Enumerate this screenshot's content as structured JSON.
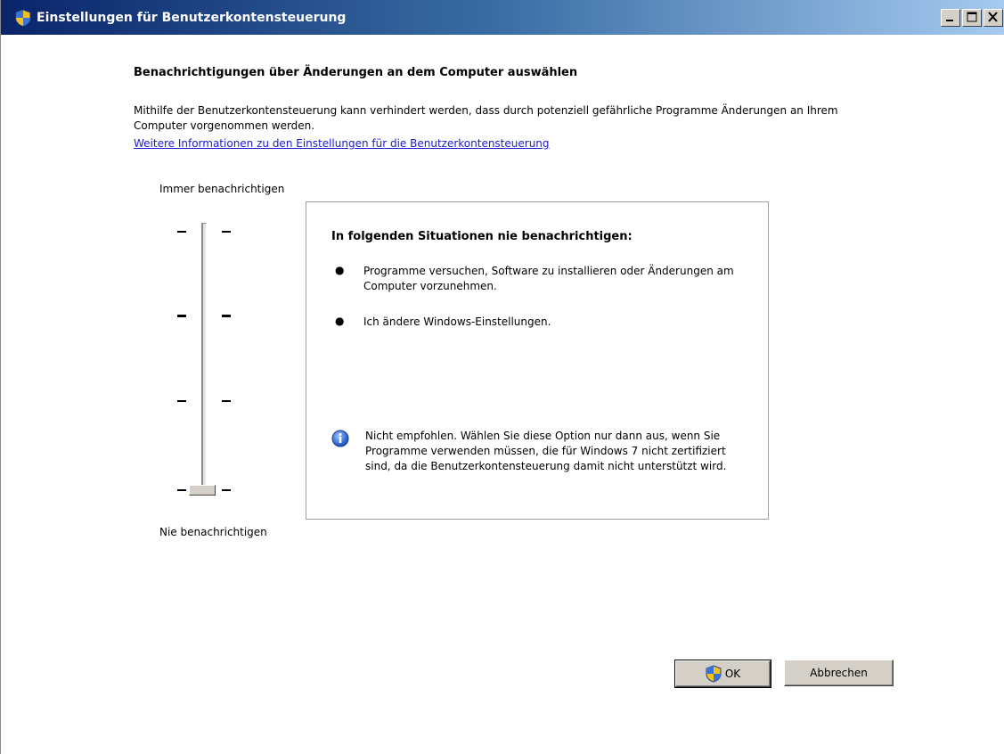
{
  "window": {
    "title": "Einstellungen für Benutzerkontensteuerung",
    "icon": "uac-shield-icon"
  },
  "main": {
    "heading": "Benachrichtigungen über Änderungen an dem Computer auswählen",
    "description": "Mithilfe der Benutzerkontensteuerung kann verhindert werden, dass durch potenziell gefährliche Programme Änderungen an Ihrem Computer vorgenommen werden.",
    "link": "Weitere Informationen zu den Einstellungen für die Benutzerkontensteuerung"
  },
  "slider": {
    "top_label": "Immer benachrichtigen",
    "bottom_label": "Nie benachrichtigen",
    "levels": 4,
    "selected_level": 1
  },
  "info": {
    "title": "In folgenden Situationen nie benachrichtigen:",
    "bullets": [
      "Programme versuchen, Software zu installieren oder Änderungen am Computer vorzunehmen.",
      "Ich ändere Windows-Einstellungen."
    ],
    "warning": "Nicht empfohlen. Wählen Sie diese Option nur dann aus, wenn Sie Programme verwenden müssen, die für Windows 7 nicht zertifiziert sind, da die Benutzerkontensteuerung damit nicht unterstützt wird."
  },
  "buttons": {
    "ok": "OK",
    "cancel": "Abbrechen"
  },
  "colors": {
    "title_bar_start": "#0a246a",
    "title_bar_end": "#a6caf0",
    "link": "#1a1ad0",
    "button_face": "#d4d0c8"
  }
}
